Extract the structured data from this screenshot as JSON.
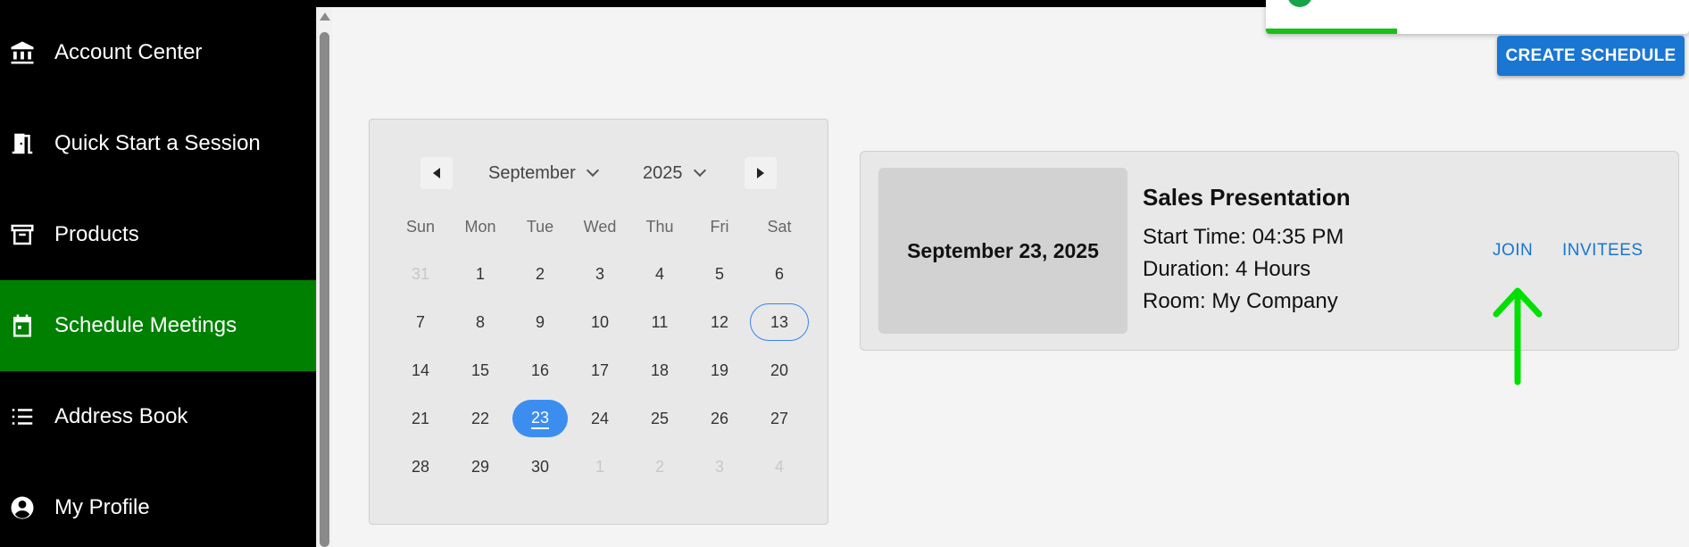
{
  "sidebar": {
    "items": [
      {
        "label": "Account Center",
        "icon": "bank-icon"
      },
      {
        "label": "Quick Start a Session",
        "icon": "door-icon"
      },
      {
        "label": "Products",
        "icon": "archive-icon"
      },
      {
        "label": "Schedule Meetings",
        "icon": "calendar-icon",
        "active": true
      },
      {
        "label": "Address Book",
        "icon": "list-icon"
      },
      {
        "label": "My Profile",
        "icon": "account-circle-icon"
      }
    ],
    "active_color": "#008000"
  },
  "toolbar": {
    "create_label": "CREATE SCHEDULE"
  },
  "notification": {
    "progress_percent": 31,
    "status_color": "#16a34a"
  },
  "calendar": {
    "month": "September",
    "year": "2025",
    "weekdays": [
      "Sun",
      "Mon",
      "Tue",
      "Wed",
      "Thu",
      "Fri",
      "Sat"
    ],
    "weeks": [
      [
        "31",
        "1",
        "2",
        "3",
        "4",
        "5",
        "6"
      ],
      [
        "7",
        "8",
        "9",
        "10",
        "11",
        "12",
        "13"
      ],
      [
        "14",
        "15",
        "16",
        "17",
        "18",
        "19",
        "20"
      ],
      [
        "21",
        "22",
        "23",
        "24",
        "25",
        "26",
        "27"
      ],
      [
        "28",
        "29",
        "30",
        "1",
        "2",
        "3",
        "4"
      ]
    ],
    "today": "13",
    "selected": "23"
  },
  "meeting": {
    "date": "September 23, 2025",
    "title": "Sales Presentation",
    "start": "Start Time: 04:35 PM",
    "duration": "Duration: 4 Hours",
    "room": "Room: My Company",
    "join_label": "JOIN",
    "invitees_label": "INVITEES"
  }
}
